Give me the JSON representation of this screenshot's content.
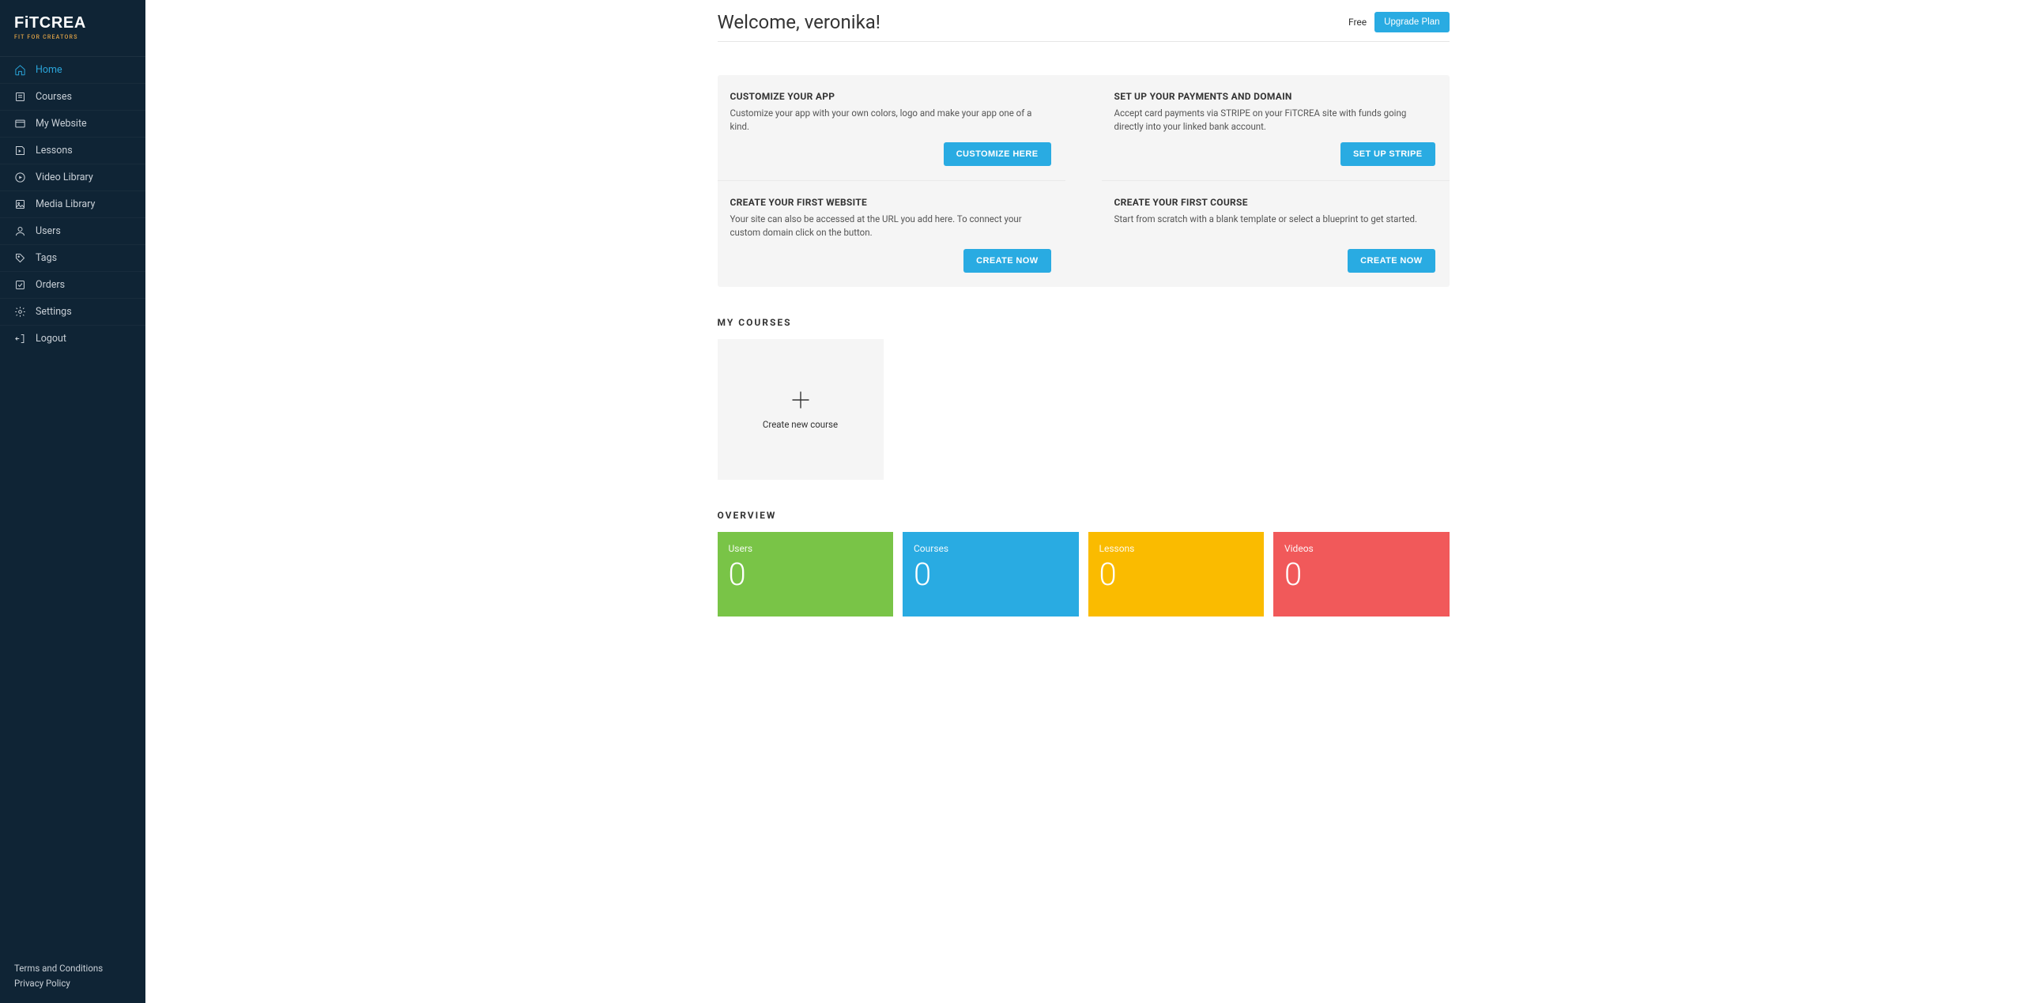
{
  "brand": {
    "name": "FiTCREA",
    "tagline": "FIT FOR CREATORS"
  },
  "sidebar": {
    "items": [
      {
        "label": "Home",
        "icon": "home-icon",
        "active": true
      },
      {
        "label": "Courses",
        "icon": "courses-icon"
      },
      {
        "label": "My Website",
        "icon": "website-icon"
      },
      {
        "label": "Lessons",
        "icon": "lessons-icon"
      },
      {
        "label": "Video Library",
        "icon": "video-icon"
      },
      {
        "label": "Media Library",
        "icon": "media-icon"
      },
      {
        "label": "Users",
        "icon": "users-icon"
      },
      {
        "label": "Tags",
        "icon": "tags-icon"
      },
      {
        "label": "Orders",
        "icon": "orders-icon"
      },
      {
        "label": "Settings",
        "icon": "settings-icon"
      },
      {
        "label": "Logout",
        "icon": "logout-icon"
      }
    ],
    "footer": {
      "terms": "Terms and Conditions",
      "privacy": "Privacy Policy"
    }
  },
  "header": {
    "welcome": "Welcome, veronika!",
    "plan": "Free",
    "upgrade": "Upgrade Plan"
  },
  "setup": [
    {
      "title": "CUSTOMIZE YOUR APP",
      "desc": "Customize your app with your own colors, logo and make your app one of a kind.",
      "button": "CUSTOMIZE HERE"
    },
    {
      "title": "SET UP YOUR PAYMENTS AND DOMAIN",
      "desc": "Accept card payments via STRIPE on your FiTCREA site with funds going directly into your linked bank account.",
      "button": "SET UP STRIPE"
    },
    {
      "title": "CREATE YOUR FIRST WEBSITE",
      "desc": "Your site can also be accessed at the URL you add here. To connect your custom domain click on the button.",
      "button": "CREATE NOW"
    },
    {
      "title": "CREATE YOUR FIRST COURSE",
      "desc": "Start from scratch with a blank template or select a blueprint to get started.",
      "button": "CREATE NOW"
    }
  ],
  "sections": {
    "courses_title": "MY COURSES",
    "overview_title": "OVERVIEW"
  },
  "courses": {
    "create_label": "Create new course"
  },
  "overview": [
    {
      "label": "Users",
      "value": "0",
      "color": "stat-green"
    },
    {
      "label": "Courses",
      "value": "0",
      "color": "stat-blue"
    },
    {
      "label": "Lessons",
      "value": "0",
      "color": "stat-yellow"
    },
    {
      "label": "Videos",
      "value": "0",
      "color": "stat-red"
    }
  ]
}
